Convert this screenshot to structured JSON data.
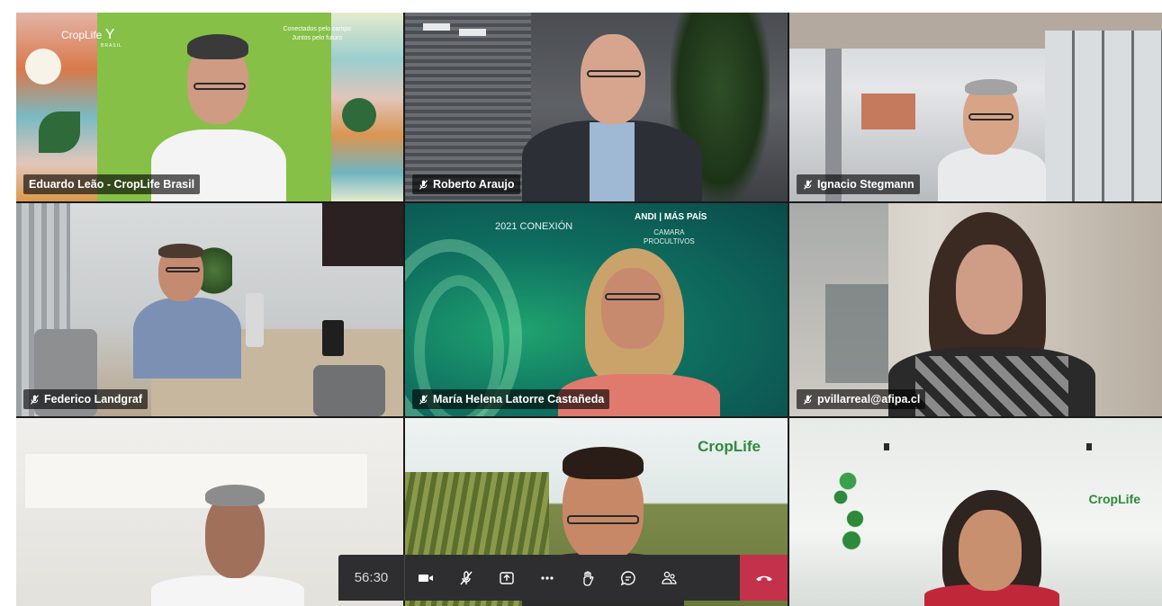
{
  "meeting": {
    "timer": "56:30"
  },
  "participants": [
    {
      "name": "Eduardo Leão - CropLife Brasil",
      "muted": false
    },
    {
      "name": "Roberto Araujo",
      "muted": true
    },
    {
      "name": "Ignacio Stegmann",
      "muted": true
    },
    {
      "name": "Federico Landgraf",
      "muted": true
    },
    {
      "name": "María Helena Latorre Castañeda",
      "muted": true
    },
    {
      "name": "pvillarreal@afipa.cl",
      "muted": true
    }
  ],
  "backgrounds": {
    "tile1_logo": "CropLife",
    "tile1_logo_sub": "BRASIL",
    "tile1_tagline_1": "Conectados pelo campo",
    "tile1_tagline_2": "Juntos pelo futuro",
    "tile5_event": "2021 CONEXIÓN",
    "tile5_andi": "ANDI",
    "tile5_maspais": "MÁS PAÍS",
    "tile5_camara_1": "CAMARA",
    "tile5_camara_2": "PROCULTIVOS",
    "tile8_logo": "CropLife",
    "tile9_logo": "CropLife"
  },
  "toolbar": {
    "buttons": [
      "camera-icon",
      "mic-off-icon",
      "share-icon",
      "more-icon",
      "raise-hand-icon",
      "chat-icon",
      "participants-icon",
      "hangup-icon"
    ]
  },
  "colors": {
    "green_bg": "#7fbf3f",
    "teal_bg": "#0d7a6f",
    "toolbar": "#2e2e30",
    "hangup": "#c4314b"
  }
}
